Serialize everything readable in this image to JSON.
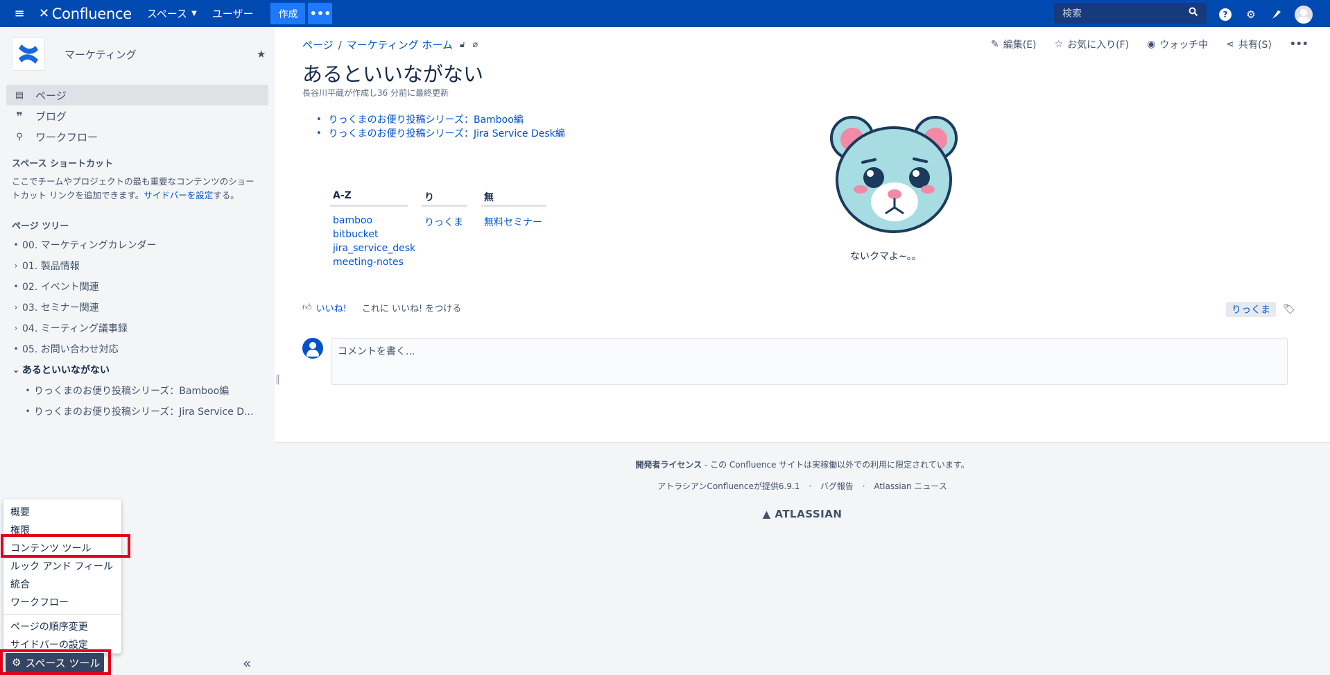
{
  "topnav": {
    "product": "Confluence",
    "spaces": "スペース",
    "people": "ユーザー",
    "create": "作成",
    "more": "•••",
    "search_placeholder": "検索",
    "brand_color": "#0049b0"
  },
  "sidebar": {
    "space_name": "マーケティング",
    "nav": [
      {
        "label": "ページ",
        "icon": "page-icon"
      },
      {
        "label": "ブログ",
        "icon": "quote-icon"
      },
      {
        "label": "ワークフロー",
        "icon": "workflow-icon"
      }
    ],
    "shortcut_title": "スペース ショートカット",
    "shortcut_text": "ここでチームやプロジェクトの最も重要なコンテンツのショートカット リンクを追加できます。",
    "shortcut_link": "サイドバーを設定",
    "shortcut_suffix": "する。",
    "tree_title": "ページ ツリー",
    "tree": [
      "00. マーケティングカレンダー",
      "01. 製品情報",
      "02. イベント関連",
      "03. セミナー関連",
      "04. ミーティング議事録",
      "05. お問い合わせ対応",
      "あるといいながない",
      "りっくまのお便り投稿シリーズ：Bamboo編",
      "りっくまのお便り投稿シリーズ：Jira Service D..."
    ],
    "tools_menu": [
      "概要",
      "権限",
      "コンテンツ ツール",
      "ルック アンド フィール",
      "統合",
      "ワークフロー",
      "ページの順序変更",
      "サイドバーの設定"
    ],
    "tools_button": "スペース ツール"
  },
  "page": {
    "breadcrumb": [
      "ページ",
      "マーケティング ホーム"
    ],
    "actions": {
      "edit": "編集(E)",
      "favorite": "お気に入り(F)",
      "watch": "ウォッチ中",
      "share": "共有(S)"
    },
    "title": "あるといいながない",
    "byline": "長谷川平蔵が作成し36 分前に最終更新",
    "child_links": [
      "りっくまのお便り投稿シリーズ：Bamboo編",
      "りっくまのお便り投稿シリーズ：Jira Service Desk編"
    ],
    "label_table": [
      {
        "head": "A-Z",
        "values": [
          "bamboo",
          "bitbucket",
          "jira_service_desk",
          "meeting-notes"
        ]
      },
      {
        "head": "り",
        "values": [
          "りっくま"
        ]
      },
      {
        "head": "無",
        "values": [
          "無料セミナー"
        ]
      }
    ],
    "image_caption": "ないクマよ~。。",
    "like": "いいね!",
    "like_hint_prefix": "これに",
    "like_hint_link": "いいね!",
    "like_hint_suffix": "をつける",
    "label_tag": "りっくま",
    "comment_placeholder": "コメントを書く..."
  },
  "footer": {
    "license_bold": "開発者ライセンス",
    "license_rest": " - この Confluence サイトは実稼働以外での利用に限定されています。",
    "powered": "アトラシアンConfluenceが提供6.9.1",
    "bug": "バグ報告",
    "news": "Atlassian ニュース",
    "atlassian": "ATLASSIAN"
  },
  "colors": {
    "highlight": "#e2001a",
    "link": "#0052cc"
  }
}
